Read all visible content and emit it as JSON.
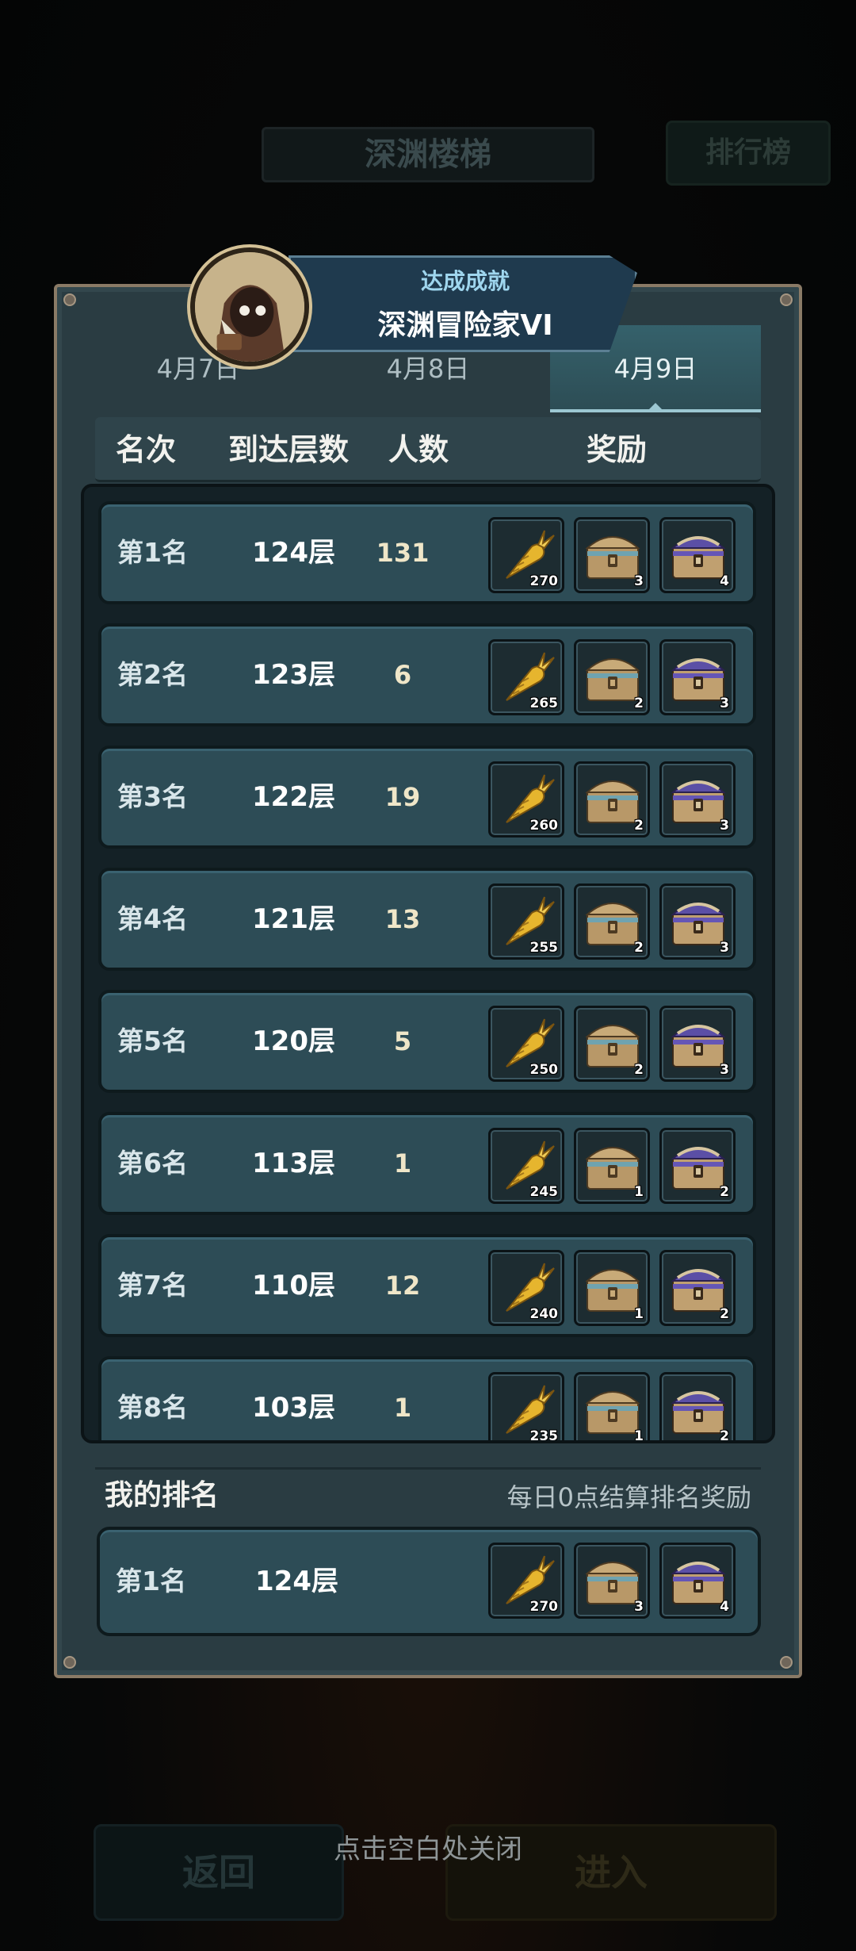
{
  "background": {
    "title": "深渊楼梯",
    "leaderboard_label": "排行榜",
    "back_label": "返回",
    "enter_label": "进入"
  },
  "close_hint": "点击空白处关闭",
  "achievement": {
    "title": "达成成就",
    "name": "深渊冒险家VI"
  },
  "tabs": [
    {
      "label": "4月7日",
      "active": false
    },
    {
      "label": "4月8日",
      "active": false
    },
    {
      "label": "4月9日",
      "active": true
    }
  ],
  "columns": [
    "名次",
    "到达层数",
    "人数",
    "奖励"
  ],
  "rows": [
    {
      "rank": "第1名",
      "floor": "124层",
      "people": "131",
      "rewards": [
        "270",
        "3",
        "4"
      ]
    },
    {
      "rank": "第2名",
      "floor": "123层",
      "people": "6",
      "rewards": [
        "265",
        "2",
        "3"
      ]
    },
    {
      "rank": "第3名",
      "floor": "122层",
      "people": "19",
      "rewards": [
        "260",
        "2",
        "3"
      ]
    },
    {
      "rank": "第4名",
      "floor": "121层",
      "people": "13",
      "rewards": [
        "255",
        "2",
        "3"
      ]
    },
    {
      "rank": "第5名",
      "floor": "120层",
      "people": "5",
      "rewards": [
        "250",
        "2",
        "3"
      ]
    },
    {
      "rank": "第6名",
      "floor": "113层",
      "people": "1",
      "rewards": [
        "245",
        "1",
        "2"
      ]
    },
    {
      "rank": "第7名",
      "floor": "110层",
      "people": "12",
      "rewards": [
        "240",
        "1",
        "2"
      ]
    },
    {
      "rank": "第8名",
      "floor": "103层",
      "people": "1",
      "rewards": [
        "235",
        "1",
        "2"
      ]
    }
  ],
  "reward_icons": [
    "golden-carrot-icon",
    "gold-chest-icon",
    "purple-chest-icon"
  ],
  "my_rank": {
    "title": "我的排名",
    "note": "每日0点结算排名奖励",
    "rank": "第1名",
    "floor": "124层",
    "rewards": [
      "270",
      "3",
      "4"
    ]
  }
}
